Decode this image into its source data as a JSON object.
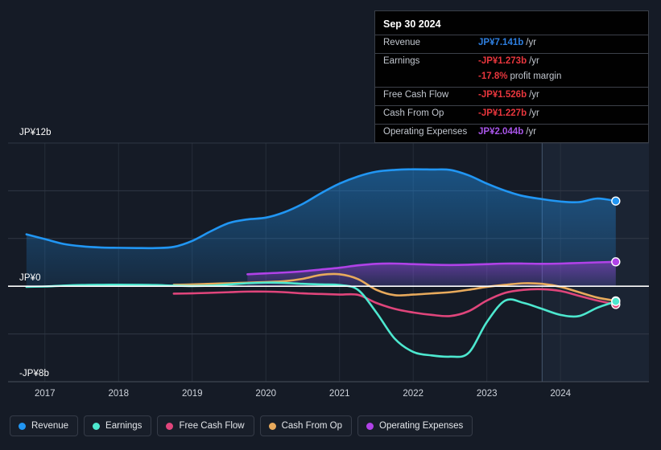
{
  "tooltip": {
    "date": "Sep 30 2024",
    "rows": [
      {
        "key": "Revenue",
        "value": "JP¥7.141b",
        "suffix": "/yr",
        "color": "blue"
      },
      {
        "key": "Earnings",
        "value": "-JP¥1.273b",
        "suffix": "/yr",
        "color": "red"
      },
      {
        "key": "",
        "value": "-17.8%",
        "suffix": "profit margin",
        "color": "red"
      },
      {
        "key": "Free Cash Flow",
        "value": "-JP¥1.526b",
        "suffix": "/yr",
        "color": "red"
      },
      {
        "key": "Cash From Op",
        "value": "-JP¥1.227b",
        "suffix": "/yr",
        "color": "red"
      },
      {
        "key": "Operating Expenses",
        "value": "JP¥2.044b",
        "suffix": "/yr",
        "color": "purple"
      }
    ]
  },
  "legend": {
    "items": [
      {
        "label": "Revenue",
        "color": "#2196f3"
      },
      {
        "label": "Earnings",
        "color": "#4de8cf"
      },
      {
        "label": "Free Cash Flow",
        "color": "#e0457b"
      },
      {
        "label": "Cash From Op",
        "color": "#e8aa5c"
      },
      {
        "label": "Operating Expenses",
        "color": "#b042e8"
      }
    ]
  },
  "axes": {
    "y_top": "JP¥12b",
    "y_zero": "JP¥0",
    "y_bottom": "-JP¥8b",
    "x_ticks": [
      "2017",
      "2018",
      "2019",
      "2020",
      "2021",
      "2022",
      "2023",
      "2024"
    ]
  },
  "chart_data": {
    "type": "area",
    "title": "",
    "xlabel": "",
    "ylabel": "JP¥",
    "ylim": [
      -8,
      12
    ],
    "xlim": [
      2016.5,
      2025.2
    ],
    "grid": true,
    "legend_position": "bottom",
    "currency": "JP¥ (billions)",
    "forecast_start": 2023.75,
    "x": [
      2016.75,
      2017.0,
      2017.25,
      2017.5,
      2017.75,
      2018.0,
      2018.25,
      2018.5,
      2018.75,
      2019.0,
      2019.25,
      2019.5,
      2019.75,
      2020.0,
      2020.25,
      2020.5,
      2020.75,
      2021.0,
      2021.25,
      2021.5,
      2021.75,
      2022.0,
      2022.25,
      2022.5,
      2022.75,
      2023.0,
      2023.25,
      2023.5,
      2023.75,
      2024.0,
      2024.25,
      2024.5,
      2024.75
    ],
    "series": [
      {
        "name": "Revenue",
        "color": "#2196f3",
        "values": [
          4.35,
          3.95,
          3.55,
          3.35,
          3.25,
          3.22,
          3.2,
          3.2,
          3.3,
          3.8,
          4.6,
          5.3,
          5.6,
          5.75,
          6.2,
          6.9,
          7.8,
          8.6,
          9.2,
          9.6,
          9.75,
          9.8,
          9.78,
          9.75,
          9.3,
          8.6,
          8.0,
          7.55,
          7.3,
          7.1,
          7.05,
          7.35,
          7.141
        ]
      },
      {
        "name": "Earnings",
        "color": "#4de8cf",
        "values": [
          -0.05,
          -0.02,
          0.05,
          0.1,
          0.12,
          0.13,
          0.12,
          0.1,
          0.05,
          0.02,
          0.05,
          0.15,
          0.25,
          0.3,
          0.28,
          0.2,
          0.15,
          0.1,
          -0.3,
          -2.2,
          -4.4,
          -5.5,
          -5.8,
          -5.9,
          -5.6,
          -3.0,
          -1.2,
          -1.4,
          -1.9,
          -2.4,
          -2.5,
          -1.8,
          -1.273
        ]
      },
      {
        "name": "Free Cash Flow",
        "color": "#e0457b",
        "values": [
          null,
          null,
          null,
          null,
          null,
          null,
          null,
          null,
          -0.62,
          -0.6,
          -0.55,
          -0.5,
          -0.45,
          -0.45,
          -0.5,
          -0.6,
          -0.65,
          -0.7,
          -0.72,
          -1.4,
          -1.9,
          -2.2,
          -2.4,
          -2.5,
          -2.1,
          -1.2,
          -0.55,
          -0.3,
          -0.25,
          -0.4,
          -0.8,
          -1.2,
          -1.526
        ]
      },
      {
        "name": "Cash From Op",
        "color": "#e8aa5c",
        "values": [
          null,
          null,
          null,
          null,
          null,
          null,
          null,
          null,
          0.12,
          0.15,
          0.2,
          0.25,
          0.3,
          0.35,
          0.42,
          0.62,
          0.95,
          1.0,
          0.6,
          -0.3,
          -0.75,
          -0.7,
          -0.6,
          -0.5,
          -0.3,
          -0.05,
          0.12,
          0.25,
          0.2,
          -0.05,
          -0.5,
          -0.95,
          -1.227
        ]
      },
      {
        "name": "Operating Expenses",
        "color": "#b042e8",
        "values": [
          null,
          null,
          null,
          null,
          null,
          null,
          null,
          null,
          null,
          null,
          null,
          null,
          1.0,
          1.08,
          1.15,
          1.25,
          1.4,
          1.55,
          1.75,
          1.88,
          1.9,
          1.85,
          1.8,
          1.78,
          1.8,
          1.85,
          1.9,
          1.9,
          1.88,
          1.9,
          1.95,
          2.0,
          2.044
        ]
      }
    ]
  }
}
